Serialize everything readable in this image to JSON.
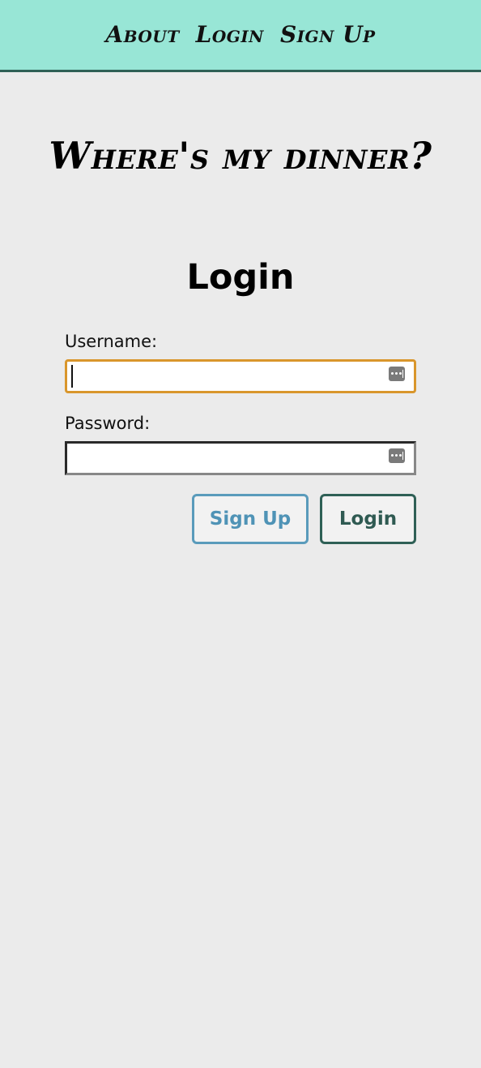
{
  "nav": {
    "items": [
      "About",
      "Login",
      "Sign Up"
    ]
  },
  "site_title": "Where's my dinner?",
  "form": {
    "heading": "Login",
    "username_label": "Username:",
    "username_value": "",
    "password_label": "Password:",
    "password_value": "",
    "signup_button": "Sign Up",
    "login_button": "Login"
  },
  "colors": {
    "navbar_bg": "#98e6d6",
    "navbar_border": "#2f6056",
    "page_bg": "#ebebeb",
    "focus_border": "#d9962c",
    "signup_accent": "#5a9bbb",
    "login_accent": "#2f6056"
  }
}
